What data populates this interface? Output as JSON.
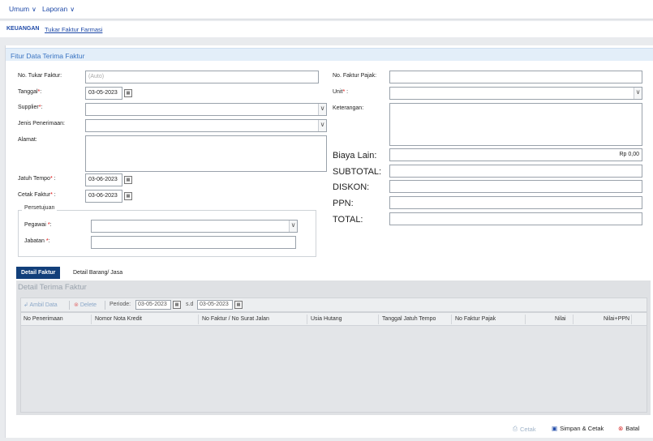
{
  "topbar": {
    "menu": [
      {
        "label": "Umum"
      },
      {
        "label": "Laporan"
      }
    ]
  },
  "breadcrumb": {
    "root": "KEUANGAN",
    "current": "Tukar Faktur Farmasi"
  },
  "panel": {
    "title": "Fitur Data Terima Faktur"
  },
  "form_left": {
    "no_tukar_faktur": {
      "label": "No. Tukar Faktur:",
      "placeholder": "(Auto)"
    },
    "tanggal": {
      "label": "Tanggal",
      "suffix": ":",
      "value": "03-05-2023"
    },
    "supplier": {
      "label": "Supplier",
      "suffix": ":",
      "value": ""
    },
    "jenis_penerimaan": {
      "label": "Jenis Penerimaan:",
      "value": ""
    },
    "alamat": {
      "label": "Alamat:",
      "value": ""
    },
    "jatuh_tempo": {
      "label": "Jatuh Tempo",
      "suffix": " :",
      "value": "03-06-2023"
    },
    "cetak_faktur": {
      "label": "Cetak Faktur",
      "suffix": " :",
      "value": "03-06-2023"
    }
  },
  "approval": {
    "legend": "Persetujuan",
    "pegawai": {
      "label": "Pegawai",
      "suffix": ":",
      "value": ""
    },
    "jabatan": {
      "label": "Jabatan",
      "suffix": ":",
      "value": ""
    }
  },
  "form_right": {
    "no_faktur_pajak": {
      "label": "No. Faktur Pajak:",
      "value": ""
    },
    "unit": {
      "label": "Unit",
      "suffix": " :",
      "value": ""
    },
    "keterangan": {
      "label": "Keterangan:",
      "value": ""
    },
    "biaya_lain": {
      "label": "Biaya Lain:",
      "value": "Rp 0,00"
    },
    "subtotal": {
      "label": "SUBTOTAL:",
      "value": ""
    },
    "diskon": {
      "label": "DISKON:",
      "value": ""
    },
    "ppn": {
      "label": "PPN:",
      "value": ""
    },
    "total": {
      "label": "TOTAL:",
      "value": ""
    }
  },
  "required_mark": "*",
  "tabs": [
    {
      "label": "Detail Faktur",
      "active": true
    },
    {
      "label": "Detail Barang/ Jasa",
      "active": false
    }
  ],
  "detail": {
    "title": "Detail Terima Faktur",
    "toolbar": {
      "ambil_data": "Ambil Data",
      "delete": "Delete",
      "periode_label": "Periode:",
      "periode_from": "03-05-2023",
      "sd_label": "s.d",
      "periode_to": "03-05-2023"
    },
    "columns": [
      "No Penerimaan",
      "Nomor Nota Kredit",
      "No Faktur / No Surat Jalan",
      "Usia Hutang",
      "Tanggal Jatuh Tempo",
      "No Faktur Pajak",
      "Nilai",
      "Nilai+PPN"
    ],
    "rows": []
  },
  "footer": {
    "cetak": "Cetak",
    "simpan_cetak": "Simpan & Cetak",
    "batal": "Batal"
  },
  "colors": {
    "accent": "#1f4aa8",
    "tab_active": "#123f7a",
    "panel_header": "#e3eef9",
    "required": "#dd0000",
    "cancel": "#d92b2b"
  }
}
